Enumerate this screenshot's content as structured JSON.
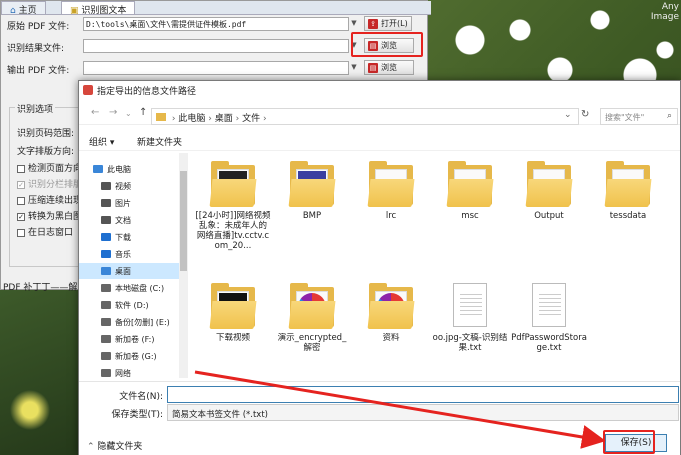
{
  "background": {
    "watermark": [
      "Any",
      "Image"
    ]
  },
  "app": {
    "tabs": [
      "主页",
      "识别图文本"
    ],
    "rows": [
      {
        "label": "原始 PDF 文件:",
        "value": "D:\\tools\\桌面\\文件\\需提供证件模板.pdf",
        "button": "打开(L)"
      },
      {
        "label": "识别结果文件:",
        "value": "",
        "button": "浏览"
      },
      {
        "label": "输出 PDF 文件:",
        "value": "",
        "button": "浏览"
      }
    ],
    "group_title": "识别选项",
    "options": [
      "识别页码范围:",
      "文字排版方向:",
      "检测页面方向",
      "识别分栏排版",
      "压缩连续出现",
      "转换为黑白图",
      "在日志窗口"
    ],
    "footer": "PDF 补丁丁——解"
  },
  "dialog": {
    "title": "指定导出的信息文件路径",
    "path": [
      "此电脑",
      "桌面",
      "文件"
    ],
    "search_placeholder": "搜索\"文件\"",
    "organize": "组织 ▾",
    "new_folder": "新建文件夹",
    "tree": [
      {
        "label": "此电脑",
        "color": "#3a86d8"
      },
      {
        "label": "视频",
        "color": "#555"
      },
      {
        "label": "图片",
        "color": "#555"
      },
      {
        "label": "文档",
        "color": "#555"
      },
      {
        "label": "下载",
        "color": "#1e6fd0"
      },
      {
        "label": "音乐",
        "color": "#1e6fd0"
      },
      {
        "label": "桌面",
        "color": "#3a86d8"
      },
      {
        "label": "本地磁盘 (C:)",
        "color": "#666"
      },
      {
        "label": "软件 (D:)",
        "color": "#666"
      },
      {
        "label": "备份[勿删] (E:)",
        "color": "#666"
      },
      {
        "label": "新加卷 (F:)",
        "color": "#666"
      },
      {
        "label": "新加卷 (G:)",
        "color": "#666"
      },
      {
        "label": "网络",
        "color": "#666"
      }
    ],
    "files": [
      {
        "name": "[[24小时]]网络视频乱象：未成年人的网络直播]tv.cctv.com_20...",
        "kind": "folder"
      },
      {
        "name": "BMP",
        "kind": "folder"
      },
      {
        "name": "lrc",
        "kind": "folder"
      },
      {
        "name": "msc",
        "kind": "folder"
      },
      {
        "name": "Output",
        "kind": "folder"
      },
      {
        "name": "tessdata",
        "kind": "folder"
      },
      {
        "name": "下载视频",
        "kind": "folder"
      },
      {
        "name": "演示_encrypted_解密",
        "kind": "folder"
      },
      {
        "name": "资料",
        "kind": "folder"
      },
      {
        "name": "oo.jpg-文稿-识别结果.txt",
        "kind": "doc"
      },
      {
        "name": "PdfPasswordStorage.txt",
        "kind": "doc"
      }
    ],
    "filename_label": "文件名(N):",
    "filename_value": "",
    "filetype_label": "保存类型(T):",
    "filetype_value": "简易文本书签文件 (*.txt)",
    "hide_folders": "隐藏文件夹",
    "save": "保存(S)"
  }
}
